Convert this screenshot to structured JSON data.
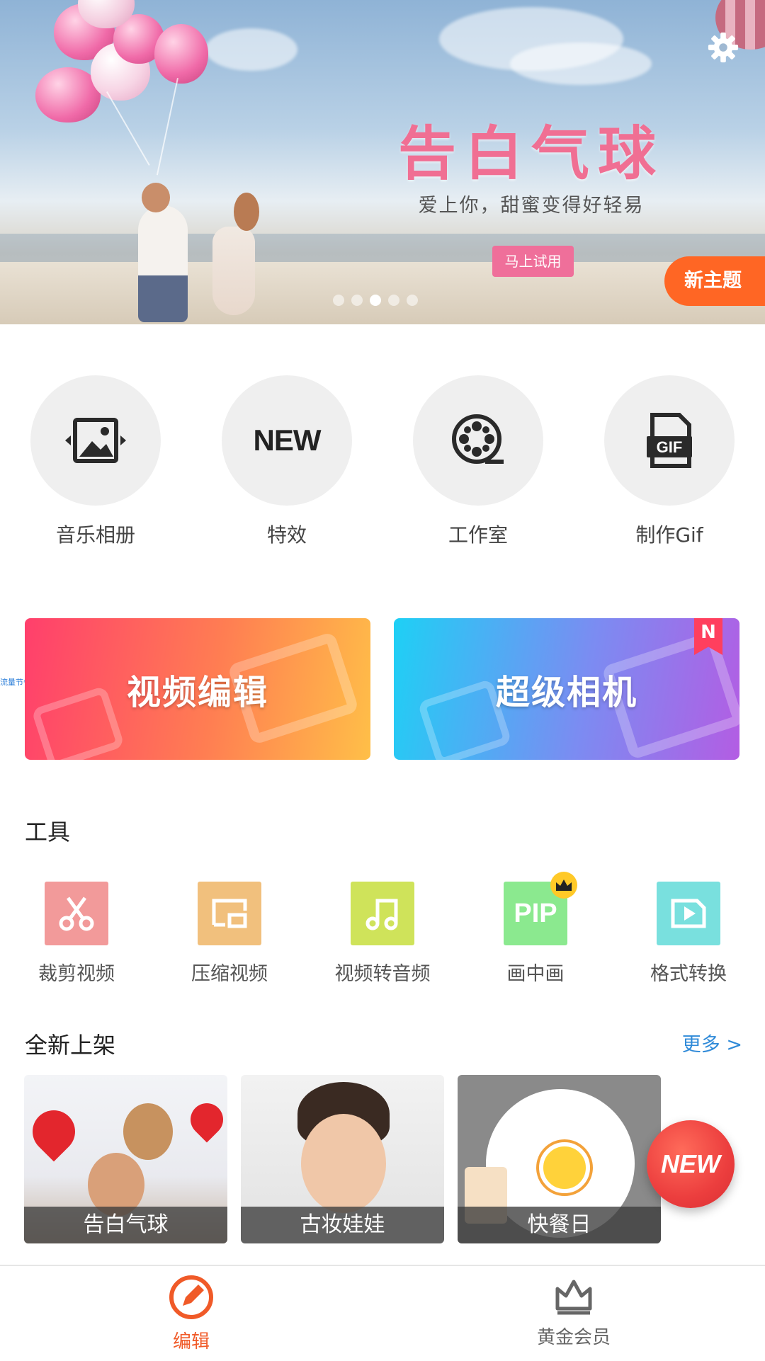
{
  "banner": {
    "title": "告白气球",
    "subtitle": "爱上你，甜蜜变得好轻易",
    "try_button": "马上试用",
    "new_theme": "新主题",
    "dots": 5,
    "active_dot": 3
  },
  "quick_actions": [
    {
      "label": "音乐相册",
      "icon": "photo-slideshow-icon"
    },
    {
      "label": "特效",
      "icon": "new-text-icon",
      "icon_text": "NEW"
    },
    {
      "label": "工作室",
      "icon": "film-reel-icon"
    },
    {
      "label": "制作Gif",
      "icon": "gif-file-icon",
      "icon_text": "GIF"
    }
  ],
  "features": {
    "video_edit": "视频编辑",
    "super_camera": "超级相机",
    "camera_badge": "N",
    "side_note": "流量节省"
  },
  "tools": {
    "title": "工具",
    "items": [
      {
        "label": "裁剪视频",
        "icon": "scissors-icon",
        "color": "#f29a9a"
      },
      {
        "label": "压缩视频",
        "icon": "compress-icon",
        "color": "#f1c07d"
      },
      {
        "label": "视频转音频",
        "icon": "music-note-icon",
        "color": "#cfe35a"
      },
      {
        "label": "画中画",
        "icon": "pip-icon",
        "icon_text": "PIP",
        "color": "#8be98f",
        "vip": true
      },
      {
        "label": "格式转换",
        "icon": "convert-icon",
        "color": "#79e0de"
      }
    ]
  },
  "new_arrivals": {
    "title": "全新上架",
    "more": "更多 >",
    "cards": [
      {
        "label": "告白气球"
      },
      {
        "label": "古妆娃娃"
      },
      {
        "label": "快餐日"
      }
    ],
    "fab": "NEW"
  },
  "bottom_nav": {
    "edit": "编辑",
    "vip": "黄金会员",
    "active_color": "#f05a28",
    "inactive_color": "#666666"
  }
}
